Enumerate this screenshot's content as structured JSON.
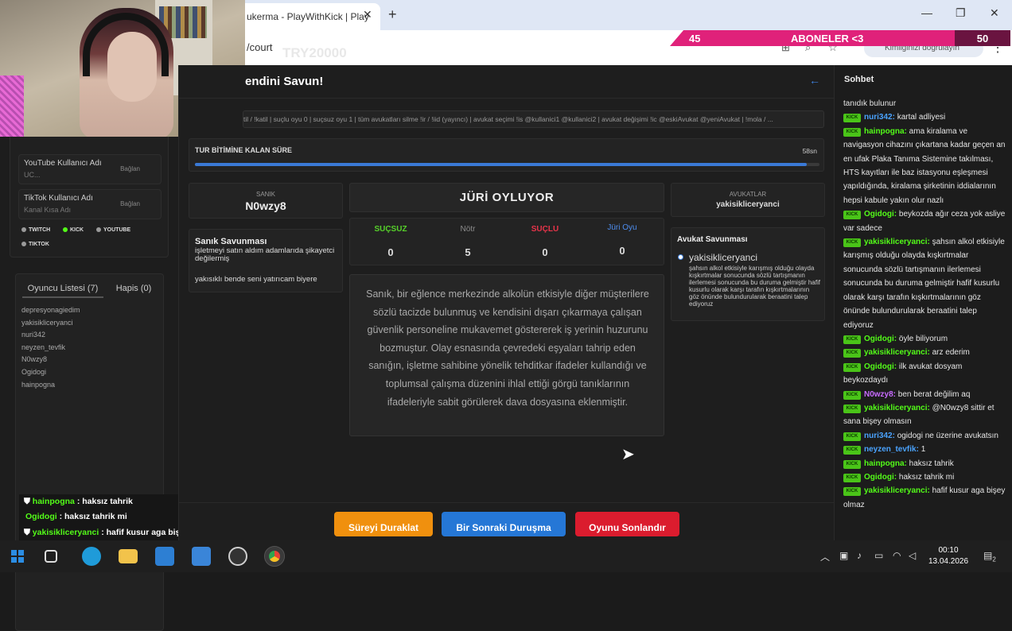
{
  "browser": {
    "tab_title": "ukerma - PlayWithKick | Play",
    "tab_close": "✕",
    "new_tab": "+",
    "url": "/court",
    "url_ghost": "TRY20000",
    "profile_text": "Kimliğinizi doğrulayın",
    "minimize": "—",
    "maximize": "❐",
    "close": "✕",
    "kebab": "⋮"
  },
  "subs_overlay": {
    "left_count": "45",
    "label": "ABONELER <3",
    "right_count": "50"
  },
  "social": {
    "items": [
      {
        "title": "YouTube Kullanıcı Adı",
        "value": "UC...",
        "button": "Bağlan"
      },
      {
        "title": "TikTok Kullanıcı Adı",
        "value": "Kanal Kısa Adı",
        "button": "Bağlan"
      }
    ],
    "platforms": [
      {
        "label": "TWITCH",
        "color": "#9a9a9a"
      },
      {
        "label": "KICK",
        "color": "#53fc18"
      },
      {
        "label": "YOUTUBE",
        "color": "#9a9a9a"
      },
      {
        "label": "TIKTOK",
        "color": "#9a9a9a"
      }
    ]
  },
  "players": {
    "tab_players": "Oyuncu Listesi (7)",
    "tab_jail": "Hapis (0)",
    "list": [
      "depresyonagiedim",
      "yakisikliceryanci",
      "nuri342",
      "neyzen_tevfik",
      "N0wzy8",
      "Ogidogi",
      "hainpogna"
    ]
  },
  "chat_overlay": [
    {
      "user": "hainpogna",
      "text": ": haksız tahrik",
      "color": "#53fc18",
      "icon": "shield-icon"
    },
    {
      "user": "Ogidogi",
      "text": ": haksız tahrik mi",
      "color": "#53fc18",
      "icon": ""
    },
    {
      "user": "yakisikliceryanci",
      "text": ": hafif kusur aga bişey olmaz",
      "color": "#53fc18",
      "icon": "shield-icon"
    }
  ],
  "main": {
    "title": "endini Savun!",
    "back_icon": "←",
    "command_text": "til / !katil | suçlu oyu 0 | suçsuz oyu 1 | tüm avukatları silme !ir / !iid (yayıncı) | avukat seçimi !is @kullanici1 @kullanici2 | avukat değişimi !ic @eskiAvukat @yeniAvukat | !mola / ...",
    "timer": {
      "label": "TUR BİTİMİNE KALAN SÜRE",
      "value": "58sn",
      "progress": 0.98
    },
    "defendant": {
      "label": "SANIK",
      "name": "N0wzy8"
    },
    "defense": {
      "title": "Sanık Savunması",
      "text1": "işletmeyi satın aldım adamlarıda şikayetci değilermiş",
      "text2": "yakısıklı bende seni yatırıcam biyere"
    },
    "jury": {
      "title": "JÜRİ OYLUYOR"
    },
    "votes": [
      {
        "label": "SUÇSUZ",
        "value": "0",
        "color": "#56d12a"
      },
      {
        "label": "Nötr",
        "value": "5",
        "color": "#8c8c8c"
      },
      {
        "label": "SUÇLU",
        "value": "0",
        "color": "#e8344a"
      },
      {
        "label": "Jüri Oyu",
        "value": "0",
        "color": "#4e8ef0"
      }
    ],
    "case_text": "Sanık, bir eğlence merkezinde alkolün etkisiyle diğer müşterilere sözlü tacizde bulunmuş ve kendisini dışarı çıkarmaya çalışan güvenlik personeline mukavemet göstererek iş yerinin huzurunu bozmuştur. Olay esnasında çevredeki eşyaları tahrip eden sanığın, işletme sahibine yönelik tehditkar ifadeler kullandığı ve toplumsal çalışma düzenini ihlal ettiği görgü tanıklarının ifadeleriyle sabit görülerek dava dosyasına eklenmiştir.",
    "lawyers": {
      "label": "AVUKATLAR",
      "name": "yakisikliceryanci"
    },
    "lawyer_defense": {
      "title": "Avukat Savunması",
      "name": "yakisikliceryanci",
      "text": "şahsın alkol etkisiyle karışmış olduğu olayda kışkırtmalar sonucunda sözlü tartışmanın ilerlemesi sonucunda bu duruma gelmiştir hafif kusurlu olarak karşı tarafın kışkırtmalarının göz önünde bulundurularak beraatini talep ediyoruz"
    },
    "buttons": [
      {
        "label": "Süreyi Duraklat",
        "color": "#f0900e"
      },
      {
        "label": "Bir Sonraki Duruşma",
        "color": "#2577d6"
      },
      {
        "label": "Oyunu Sonlandır",
        "color": "#db1c2e"
      }
    ]
  },
  "chat": {
    "title": "Sohbet",
    "messages": [
      {
        "user": "",
        "text": "tanıdık bulunur",
        "color": "#ffffff",
        "badge": ""
      },
      {
        "user": "nuri342:",
        "text": "kartal adliyesi",
        "color": "#4aa3ff",
        "badge": "KICK"
      },
      {
        "user": "hainpogna:",
        "text": "ama kiralama ve navigasyon cihazını çıkartana kadar geçen an en ufak Plaka Tanıma Sistemine takılması, HTS kayıtları ile baz istasyonu eşleşmesi yapıldığında, kiralama şirketinin iddialarının hepsi kabule yakın olur nazlı",
        "color": "#53fc18",
        "badge": "KICK"
      },
      {
        "user": "Ogidogi:",
        "text": "beykozda ağır ceza yok asliye var sadece",
        "color": "#53fc18",
        "badge": "KICK"
      },
      {
        "user": "yakisikliceryanci:",
        "text": "şahsın alkol etkisiyle karışmış olduğu olayda kışkırtmalar sonucunda sözlü tartışmanın ilerlemesi sonucunda bu duruma gelmiştir hafif kusurlu olarak karşı tarafın kışkırtmalarının göz önünde bulundurularak beraatini talep ediyoruz",
        "color": "#53fc18",
        "badge": "KICK"
      },
      {
        "user": "Ogidogi:",
        "text": "öyle biliyorum",
        "color": "#53fc18",
        "badge": "KICK"
      },
      {
        "user": "yakisikliceryanci:",
        "text": "arz ederim",
        "color": "#53fc18",
        "badge": "KICK"
      },
      {
        "user": "Ogidogi:",
        "text": "ilk avukat dosyam beykozdaydı",
        "color": "#53fc18",
        "badge": "KICK"
      },
      {
        "user": "N0wzy8:",
        "text": "ben berat değilim aq",
        "color": "#c86bff",
        "badge": "KICK"
      },
      {
        "user": "yakisikliceryanci:",
        "text": "@N0wzy8 sittir et sana bişey olmasın",
        "color": "#53fc18",
        "badge": "KICK"
      },
      {
        "user": "nuri342:",
        "text": "ogidogi ne üzerine avukatsın",
        "color": "#4aa3ff",
        "badge": "KICK"
      },
      {
        "user": "neyzen_tevfik:",
        "text": "1",
        "color": "#4aa3ff",
        "badge": "KICK"
      },
      {
        "user": "hainpogna:",
        "text": "haksız tahrik",
        "color": "#53fc18",
        "badge": "KICK"
      },
      {
        "user": "Ogidogi:",
        "text": "haksız tahrik mi",
        "color": "#53fc18",
        "badge": "KICK"
      },
      {
        "user": "yakisikliceryanci:",
        "text": "hafif kusur aga bişey olmaz",
        "color": "#53fc18",
        "badge": "KICK"
      }
    ]
  },
  "taskbar": {
    "apps": [
      {
        "name": "windows-start-icon",
        "color": "#2b8de3"
      },
      {
        "name": "task-view-icon",
        "color": "#dddddd"
      },
      {
        "name": "edge-icon",
        "color": "#1f9bd9"
      },
      {
        "name": "file-explorer-icon",
        "color": "#f2c34b"
      },
      {
        "name": "store-icon",
        "color": "#2d7fd3"
      },
      {
        "name": "mail-icon",
        "color": "#3a85d8"
      },
      {
        "name": "obs-icon",
        "color": "#cfcfcf"
      },
      {
        "name": "chrome-icon",
        "color": "#e44134"
      }
    ],
    "time": "00:10",
    "date": "13.04.2026",
    "notifications": "2"
  }
}
